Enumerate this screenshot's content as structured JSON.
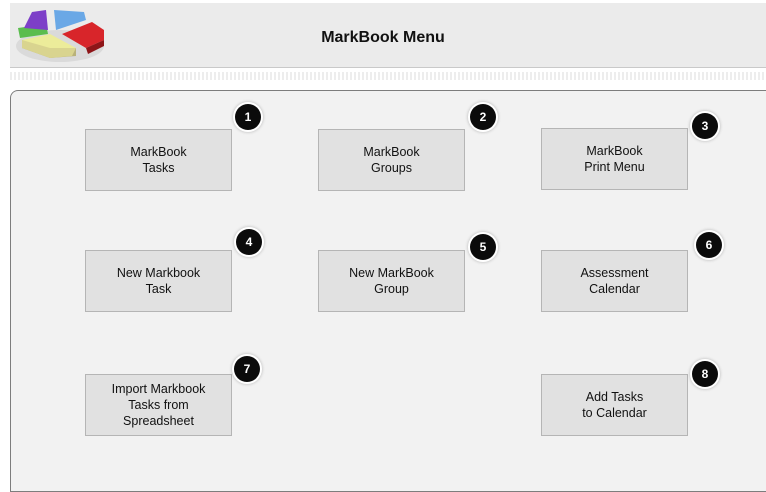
{
  "header": {
    "title": "MarkBook Menu"
  },
  "buttons": [
    {
      "label": "MarkBook\nTasks",
      "badge": "1"
    },
    {
      "label": "MarkBook\nGroups",
      "badge": "2"
    },
    {
      "label": "MarkBook\nPrint Menu",
      "badge": "3"
    },
    {
      "label": "New Markbook\nTask",
      "badge": "4"
    },
    {
      "label": "New MarkBook\nGroup",
      "badge": "5"
    },
    {
      "label": "Assessment\nCalendar",
      "badge": "6"
    },
    {
      "label": "Import Markbook\nTasks from\nSpreadsheet",
      "badge": "7"
    },
    {
      "label": "Add Tasks\nto Calendar",
      "badge": "8"
    }
  ]
}
